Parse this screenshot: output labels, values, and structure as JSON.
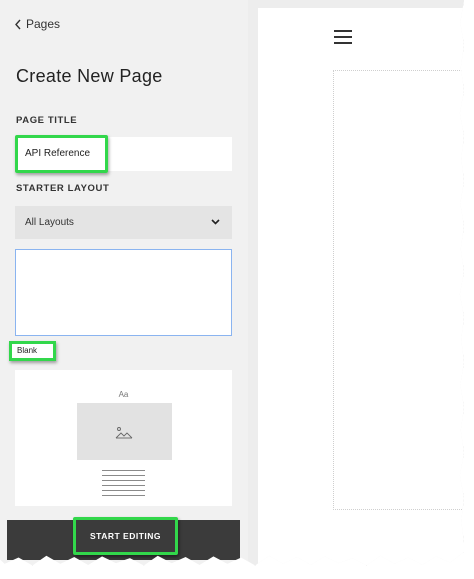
{
  "sidebar": {
    "back_label": "Pages",
    "heading": "Create New Page",
    "page_title_label": "PAGE TITLE",
    "page_title_value": "API Reference",
    "starter_layout_label": "STARTER LAYOUT",
    "layout_select_value": "All Layouts",
    "blank_label": "Blank",
    "template_placeholder_text": "Aa",
    "start_button_label": "START EDITING"
  },
  "preview": {
    "menu_icon": "hamburger-menu-icon"
  },
  "colors": {
    "highlight": "#32d74b",
    "bottom_bar": "#3b3b3b",
    "sidebar_bg": "#f1f1f1",
    "selected_border": "#8ab4f0"
  }
}
